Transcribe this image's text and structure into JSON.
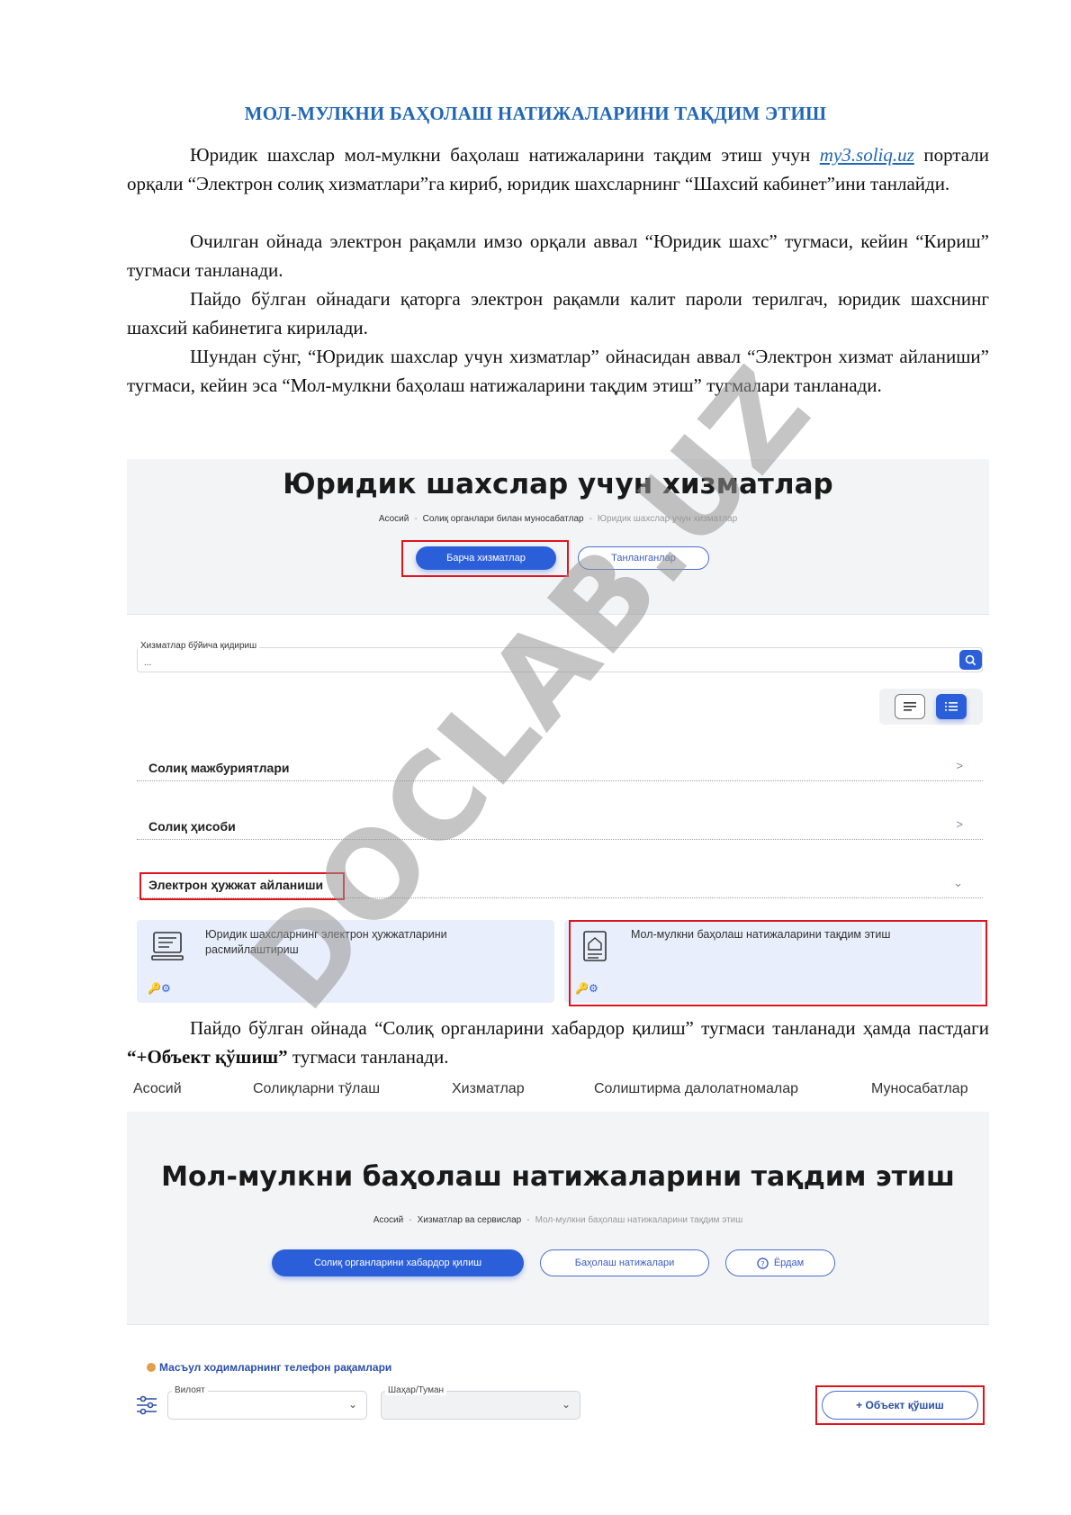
{
  "document": {
    "title": "МОЛ-МУЛКНИ БАҲОЛАШ НАТИЖАЛАРИНИ ТАҚДИМ ЭТИШ",
    "p1_before_link": "Юридик шахслар мол-мулкни баҳолаш натижаларини тақдим этиш учун ",
    "p1_link": "my3.soliq.uz",
    "p1_after_link": " портали орқали “Электрон солиқ хизматлари”га кириб, юридик шахсларнинг “Шахсий кабинет”ини танлайди.",
    "p2": "Очилган ойнада электрон рақамли имзо орқали аввал “Юридик шахс” тугмаси, кейин “Кириш” тугмаси танланади.",
    "p3": "Пайдо бўлган ойнадаги қаторга электрон рақамли калит пароли терилгач, юридик шахснинг шахсий кабинетига кирилади.",
    "p4": "Шундан сўнг, “Юридик шахслар учун хизматлар” ойнасидан аввал “Электрон хизмат айланиши” тугмаси, кейин эса “Мол-мулкни баҳолаш натижаларини тақдим этиш” тугмалари танланади.",
    "p5_start": "Пайдо бўлган ойнада “Солиқ органларини хабардор қилиш” тугмаси танланади ҳамда пастдаги ",
    "p5_bold": "“+Объект қўшиш”",
    "p5_end": " тугмаси танланади.",
    "watermark": "DOCLAB.UZ"
  },
  "screen1": {
    "title": "Юридик шахслар учун хизматлар",
    "breadcrumb": [
      "Асосий",
      "Солиқ органлари билан муносабатлар",
      "Юридик шахслар учун хизматлар"
    ],
    "btn_all": "Барча хизматлар",
    "btn_selected": "Танланганлар",
    "search_label": "Хизматлар бўйича қидириш",
    "search_value": "...",
    "sections": [
      "Солиқ мажбуриятлари",
      "Солиқ ҳисоби",
      "Электрон ҳужжат айланиши"
    ],
    "card1": "Юридик шахсларнинг электрон ҳужжатларини расмийлаштириш",
    "card2": "Мол-мулкни баҳолаш натижаларини тақдим этиш",
    "chev_right": ">",
    "chev_down": "⌄",
    "card_icons": "🔑⚙"
  },
  "screen2": {
    "nav": [
      "Асосий",
      "Солиқларни тўлаш",
      "Хизматлар",
      "Солиштирма далолатномалар",
      "Муносабатлар"
    ],
    "title": "Мол-мулкни баҳолаш натижаларини тақдим этиш",
    "breadcrumb": [
      "Асосий",
      "Хизматлар ва сервислар",
      "Мол-мулкни баҳолаш натижаларини тақдим этиш"
    ],
    "btn_notify": "Солиқ органларини хабардор қилиш",
    "btn_results": "Баҳолаш натижалари",
    "btn_help": "Ёрдам",
    "phones": "Масъул ходимларнинг телефон рақамлари",
    "region_label": "Вилоят",
    "city_label": "Шаҳар/Туман",
    "add_object": "+ Объект қўшиш"
  }
}
